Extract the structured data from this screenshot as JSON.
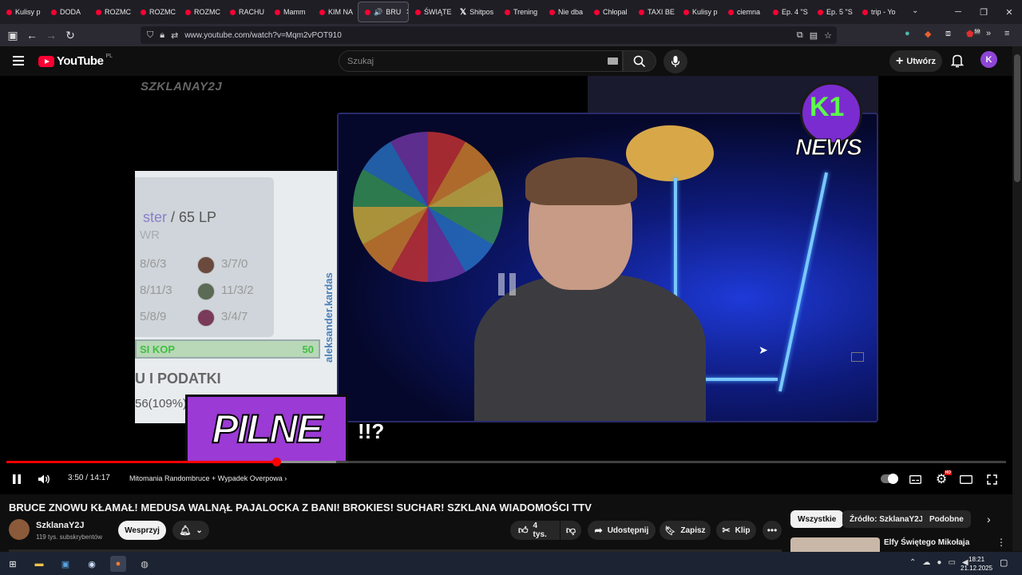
{
  "browser": {
    "tabs": [
      {
        "label": "Kulisy p"
      },
      {
        "label": "DODA"
      },
      {
        "label": "ROZMC"
      },
      {
        "label": "ROZMC"
      },
      {
        "label": "ROZMC"
      },
      {
        "label": "RACHU"
      },
      {
        "label": "Mamm"
      },
      {
        "label": "KIM NA"
      },
      {
        "label": "BRU",
        "active": true
      },
      {
        "label": "ŚWIĄTE"
      },
      {
        "label": "Shitpos"
      },
      {
        "label": "Trening"
      },
      {
        "label": "Nie dba"
      },
      {
        "label": "Chłopal"
      },
      {
        "label": "TAXI BE"
      },
      {
        "label": "Kulisy p"
      },
      {
        "label": "ciemna"
      },
      {
        "label": "Ep. 4 \"S"
      },
      {
        "label": "Ep. 5 \"S"
      },
      {
        "label": "trip - Yo"
      }
    ],
    "url": "www.youtube.com/watch?v=Mqm2vPOT910",
    "ext_badge": "59"
  },
  "youtube": {
    "logo_text": "YouTube",
    "region": "PL",
    "search_placeholder": "Szukaj",
    "create_label": "Utwórz",
    "avatar_letter": "K"
  },
  "video_frame": {
    "watermark": "SZKLANAY2J",
    "rank_text_accent": "ster",
    "rank_text_lp": " / 65 LP",
    "wr_text": "WR",
    "kda_rows": [
      {
        "left": "8/6/3",
        "right": "3/7/0"
      },
      {
        "left": "8/11/3",
        "right": "11/3/2"
      },
      {
        "left": "5/8/9",
        "right": "3/4/7"
      }
    ],
    "kop_left": "SI KOP",
    "kop_right": "50",
    "handle": "aleksander.kardas",
    "podatki": "U I PODATKI",
    "percent": "56(109%)",
    "news_logo": "K1",
    "news_text": "NEWS",
    "pilne": "PILNE",
    "excl": "!!?"
  },
  "player": {
    "time": "3:50 / 14:17",
    "chapter": "Mitomania Randombruce + Wypadek Overpowa",
    "progress_played": 0.27,
    "progress_buffered": 0.33,
    "hd_badge": "HD"
  },
  "meta": {
    "title": "BRUCE ZNOWU KŁAMAŁ! MEDUSA WALNĄŁ PAJALOCKA Z BANI! BROKIES! SUCHAR! SZKLANA WIADOMOŚCI TTV",
    "channel": "SzklanaY2J",
    "subscribers": "119 tys. subskrybentów",
    "support_label": "Wesprzyj",
    "likes": "4 tys.",
    "share_label": "Udostępnij",
    "save_label": "Zapisz",
    "clip_label": "Klip"
  },
  "sidebar": {
    "chips": [
      {
        "label": "Wszystkie"
      },
      {
        "label": "Źródło: SzklanaY2J"
      },
      {
        "label": "Podobne"
      }
    ],
    "rec_title": "Elfy Świętego Mikołaja"
  },
  "taskbar": {
    "time": "18:21",
    "date": "21.12.2025"
  }
}
